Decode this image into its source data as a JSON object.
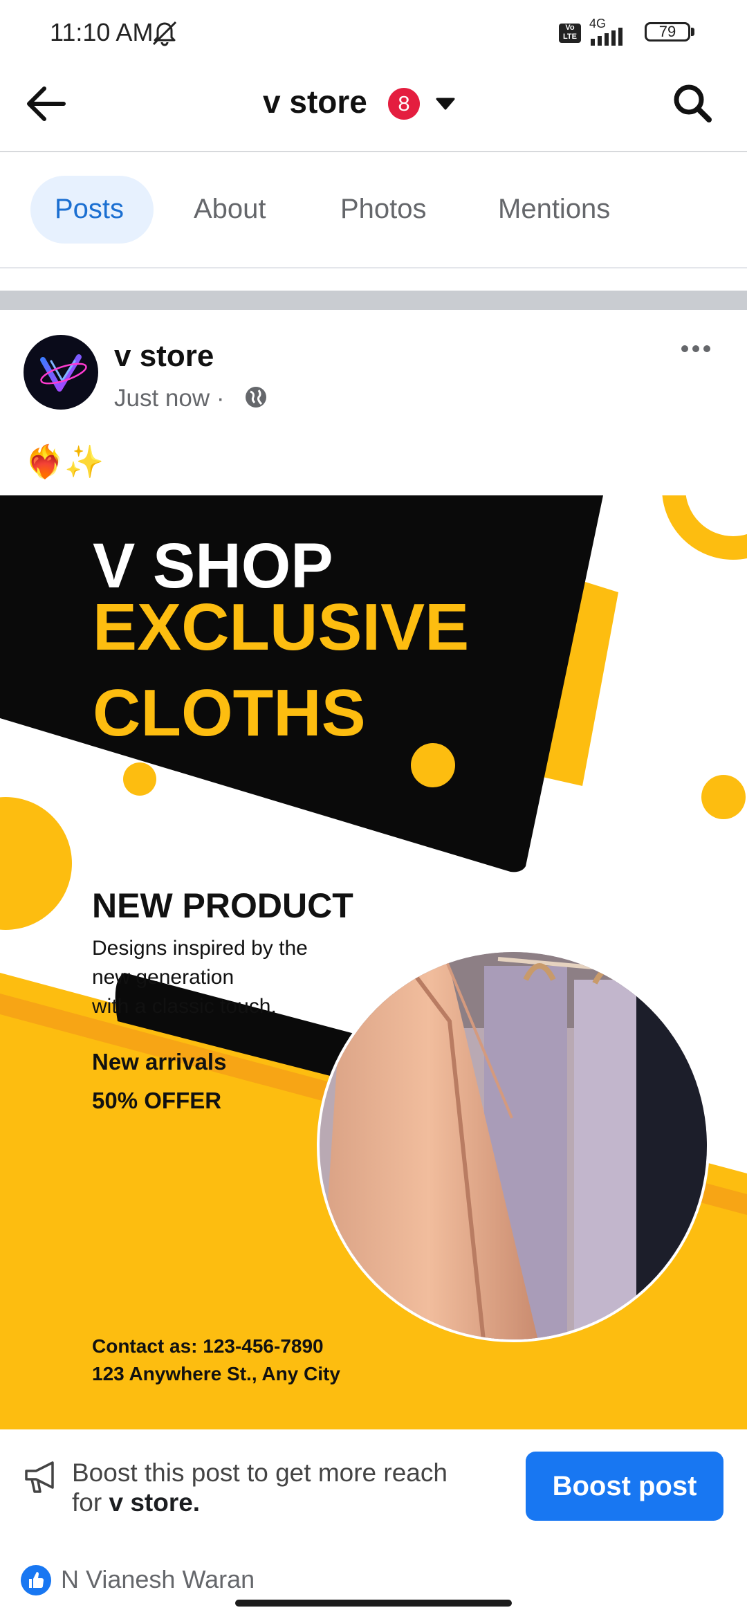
{
  "status_bar": {
    "time": "11:10 AM",
    "volte": "Vo LTE",
    "network": "4G",
    "battery": "79"
  },
  "header": {
    "title": "v store",
    "badge_count": "8"
  },
  "tabs": [
    {
      "label": "Posts",
      "active": true
    },
    {
      "label": "About",
      "active": false
    },
    {
      "label": "Photos",
      "active": false
    },
    {
      "label": "Mentions",
      "active": false
    }
  ],
  "post": {
    "author": "v store",
    "time": "Just now ·",
    "caption": "❤️‍🔥✨",
    "image": {
      "title_line1": "V SHOP",
      "title_line2": "EXCLUSIVE",
      "title_line3": "CLOTHS",
      "heading": "NEW PRODUCT",
      "desc_line1": "Designs inspired by the",
      "desc_line2": "new generation",
      "desc_line3": "with a classic touch.",
      "arrivals": "New arrivals",
      "offer": "50% OFFER",
      "contact": "Contact as: 123-456-7890",
      "address": "123 Anywhere St., Any City"
    }
  },
  "boost": {
    "text_line1": "Boost this post to get more reach",
    "text_line2_prefix": "for",
    "text_line2_name": "v store.",
    "button_label": "Boost post"
  },
  "reactions": {
    "name": "N Vianesh Waran"
  },
  "colors": {
    "accent": "#1877f2",
    "badge": "#e41e3f",
    "brand_yellow": "#fdbd10"
  },
  "icons": [
    "back-arrow-icon",
    "search-icon",
    "chevron-down-icon",
    "globe-icon",
    "more-icon",
    "megaphone-icon",
    "like-icon",
    "dnd-icon"
  ]
}
